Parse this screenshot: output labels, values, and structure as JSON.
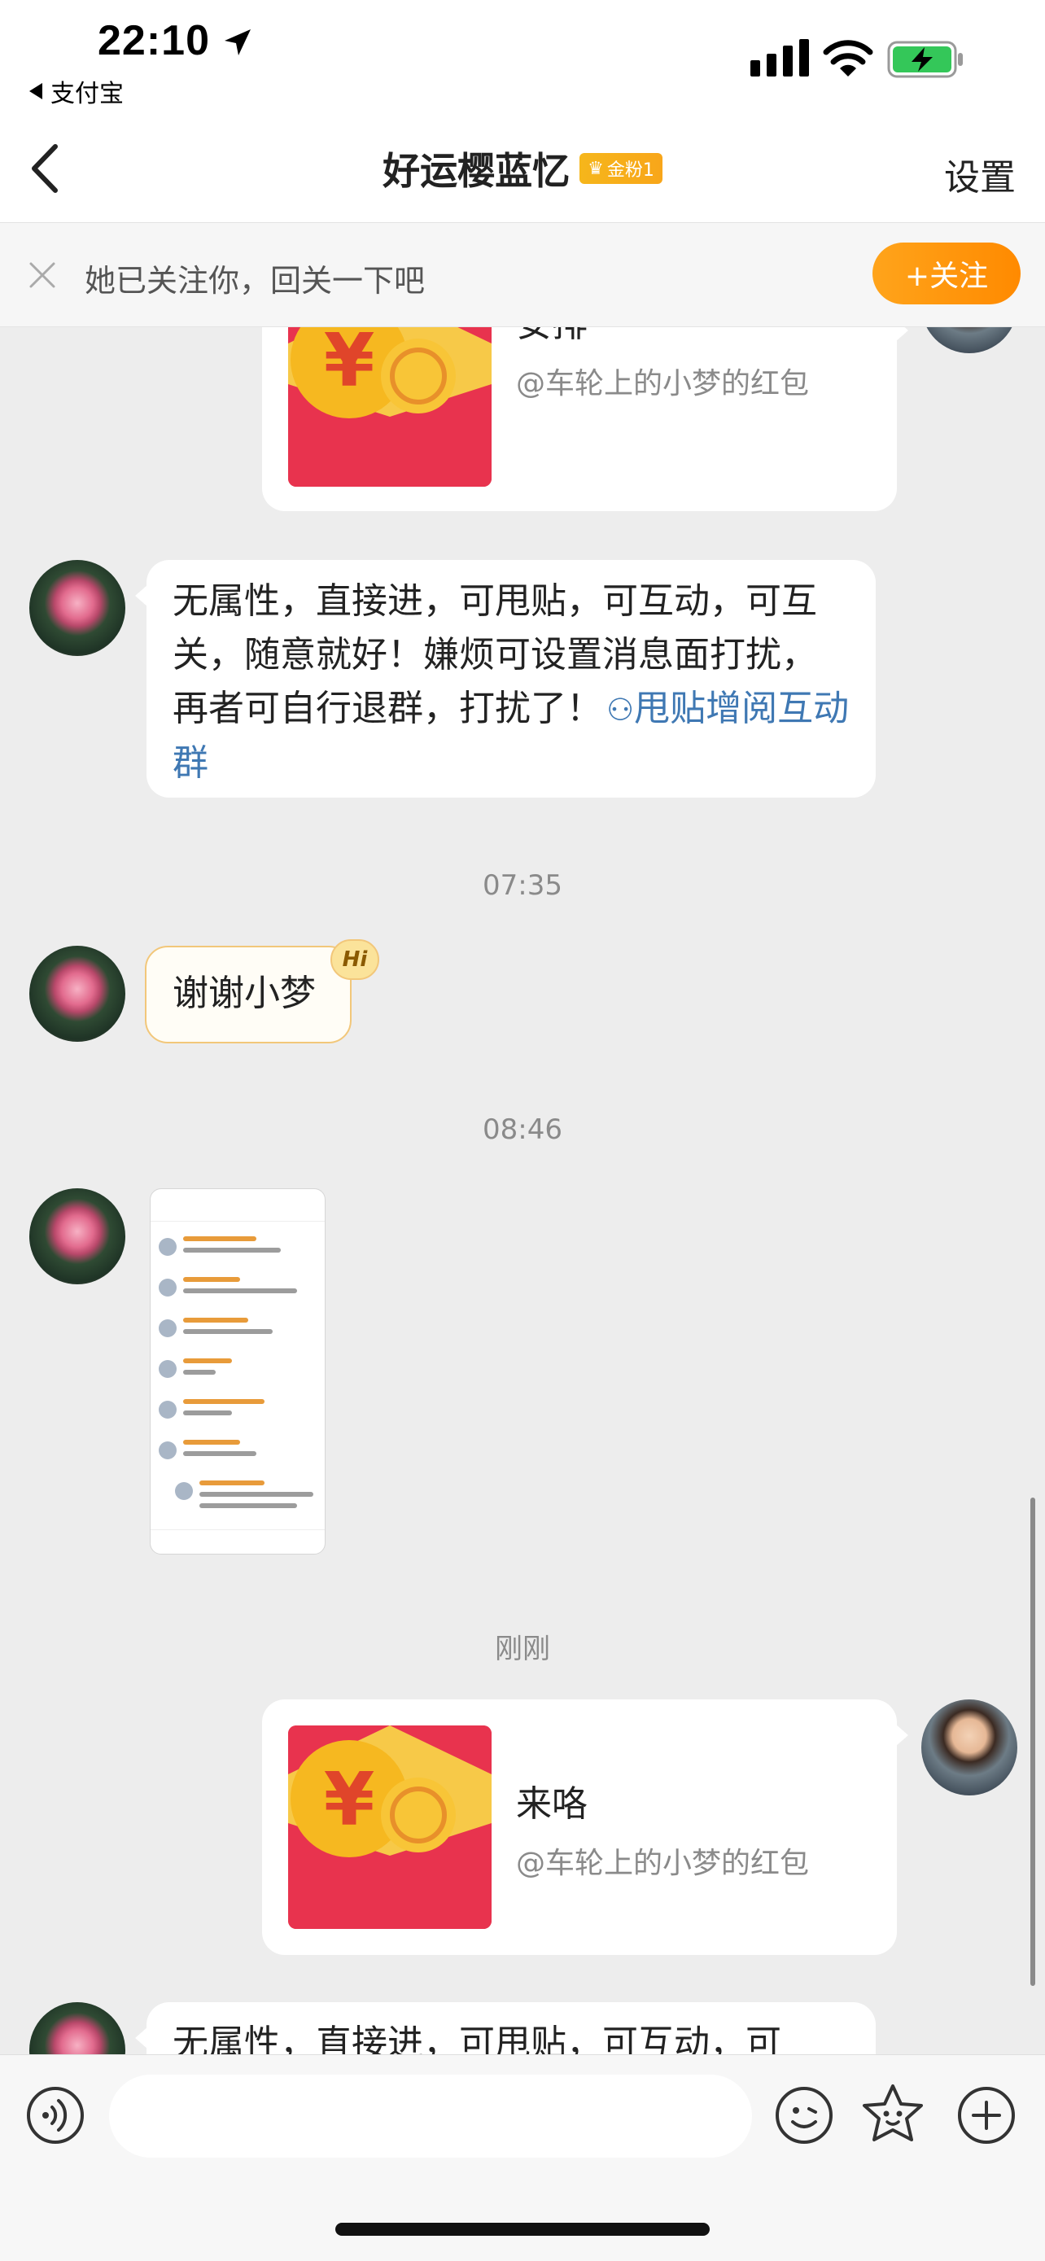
{
  "status_bar": {
    "time": "22:10",
    "back_app_label": "支付宝"
  },
  "header": {
    "title": "好运樱蓝忆",
    "fan_badge": "金粉1",
    "settings_label": "设置"
  },
  "follow_banner": {
    "text": "她已关注你，回关一下吧",
    "button_label": "+关注"
  },
  "messages": [
    {
      "type": "red_packet",
      "side": "right",
      "title": "安排",
      "subtitle": "@车轮上的小梦的红包"
    },
    {
      "type": "text",
      "side": "left",
      "text": "无属性，直接进，可甩贴，可互动，可互关，随意就好！嫌烦可设置消息面打扰，再者可自行退群，打扰了！",
      "link": "甩贴增阅互动群"
    },
    {
      "type": "timestamp",
      "text": "07:35"
    },
    {
      "type": "text",
      "side": "left",
      "text": "谢谢小梦",
      "badge": "Hi"
    },
    {
      "type": "timestamp",
      "text": "08:46"
    },
    {
      "type": "image",
      "side": "left"
    },
    {
      "type": "timestamp",
      "text": "刚刚"
    },
    {
      "type": "red_packet",
      "side": "right",
      "title": "来咯",
      "subtitle": "@车轮上的小梦的红包"
    },
    {
      "type": "text",
      "side": "left",
      "text": "无属性，直接进，可甩贴，可互动，可"
    }
  ],
  "input_bar": {
    "placeholder": ""
  },
  "icons": [
    "location-arrow-icon",
    "signal-icon",
    "wifi-icon",
    "battery-charging-icon",
    "back-chevron-icon",
    "close-icon",
    "voice-icon",
    "emoji-icon",
    "sticker-icon",
    "plus-icon"
  ],
  "colors": {
    "accent_orange": "#ff8a00",
    "link_blue": "#3f78b3",
    "red_packet": "#e8334e",
    "background": "#ededed"
  }
}
